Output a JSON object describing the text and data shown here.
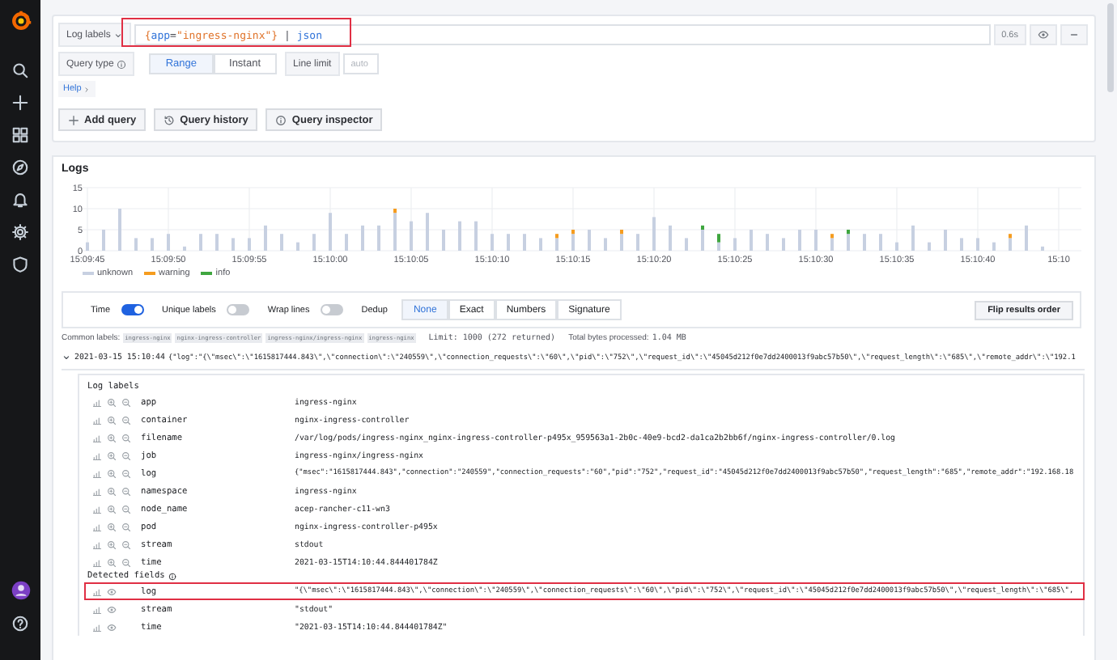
{
  "query_editor": {
    "label_browser": "Log labels",
    "highlighted": true,
    "query_tokens": [
      {
        "text": "{",
        "kind": "brace"
      },
      {
        "text": "app",
        "kind": "label"
      },
      {
        "text": "=",
        "kind": "op"
      },
      {
        "text": "\"ingress-nginx\"",
        "kind": "string"
      },
      {
        "text": "}",
        "kind": "brace"
      },
      {
        "text": " | ",
        "kind": "op"
      },
      {
        "text": "json",
        "kind": "func"
      }
    ],
    "duration": "0.6s",
    "query_type_label": "Query type",
    "query_types": [
      {
        "label": "Range",
        "selected": true
      },
      {
        "label": "Instant",
        "selected": false
      }
    ],
    "line_limit_label": "Line limit",
    "line_limit_placeholder": "auto",
    "help": "Help",
    "buttons": [
      {
        "label": "Add query",
        "kind": "add"
      },
      {
        "label": "Query history",
        "kind": "history"
      },
      {
        "label": "Query inspector",
        "kind": "inspector"
      }
    ]
  },
  "logs": {
    "title": "Logs",
    "chart_data": {
      "type": "bar",
      "stacked": true,
      "grid": true,
      "categories": [
        "15:09:45",
        null,
        null,
        null,
        null,
        "15:09:50",
        null,
        null,
        null,
        null,
        "15:09:55",
        null,
        null,
        null,
        null,
        "15:10:00",
        null,
        null,
        null,
        null,
        "15:10:05",
        null,
        null,
        null,
        null,
        "15:10:10",
        null,
        null,
        null,
        null,
        "15:10:15",
        null,
        null,
        null,
        null,
        "15:10:20",
        null,
        null,
        null,
        null,
        "15:10:25",
        null,
        null,
        null,
        null,
        "15:10:30",
        null,
        null,
        null,
        null,
        "15:10:35",
        null,
        null,
        null,
        null,
        "15:10:40",
        null,
        null,
        null,
        null,
        "15:10"
      ],
      "series": [
        {
          "name": "unknown",
          "color": "#c7d0e1",
          "values": [
            2,
            5,
            10,
            3,
            3,
            4,
            1,
            4,
            4,
            3,
            3,
            6,
            4,
            2,
            4,
            9,
            4,
            6,
            6,
            9,
            7,
            9,
            5,
            7,
            7,
            4,
            4,
            4,
            3,
            3,
            4,
            5,
            3,
            4,
            4,
            8,
            6,
            3,
            5,
            2,
            3,
            5,
            4,
            3,
            5,
            5,
            3,
            4,
            4,
            4,
            2,
            6,
            2,
            5,
            3,
            3,
            2,
            3,
            6,
            1,
            null
          ]
        },
        {
          "name": "warning",
          "color": "#f59c1f",
          "values": [
            0,
            0,
            0,
            0,
            0,
            0,
            0,
            0,
            0,
            0,
            0,
            0,
            0,
            0,
            0,
            0,
            0,
            0,
            0,
            1,
            0,
            0,
            0,
            0,
            0,
            0,
            0,
            0,
            0,
            1,
            1,
            0,
            0,
            1,
            0,
            0,
            0,
            0,
            0,
            0,
            0,
            0,
            0,
            0,
            0,
            0,
            1,
            0,
            0,
            0,
            0,
            0,
            0,
            0,
            0,
            0,
            0,
            1,
            0,
            0,
            null
          ]
        },
        {
          "name": "info",
          "color": "#3fa63f",
          "values": [
            0,
            0,
            0,
            0,
            0,
            0,
            0,
            0,
            0,
            0,
            0,
            0,
            0,
            0,
            0,
            0,
            0,
            0,
            0,
            0,
            0,
            0,
            0,
            0,
            0,
            0,
            0,
            0,
            0,
            0,
            0,
            0,
            0,
            0,
            0,
            0,
            0,
            0,
            1,
            2,
            0,
            0,
            0,
            0,
            0,
            0,
            0,
            1,
            0,
            0,
            0,
            0,
            0,
            0,
            0,
            0,
            0,
            0,
            0,
            0,
            null
          ]
        }
      ],
      "ylim": [
        0,
        15
      ],
      "yticks": [
        0,
        5,
        10,
        15
      ]
    },
    "toggles": [
      {
        "label": "Time",
        "on": true
      },
      {
        "label": "Unique labels",
        "on": false
      },
      {
        "label": "Wrap lines",
        "on": false
      }
    ],
    "dedup": {
      "label": "Dedup",
      "options": [
        {
          "label": "None",
          "selected": true
        },
        {
          "label": "Exact",
          "selected": false
        },
        {
          "label": "Numbers",
          "selected": false
        },
        {
          "label": "Signature",
          "selected": false
        }
      ]
    },
    "flip_button": "Flip results order",
    "common_labels": {
      "label": "Common labels:",
      "tags": [
        "ingress-nginx",
        "nginx-ingress-controller",
        "ingress-nginx/ingress-nginx",
        "ingress-nginx"
      ]
    },
    "limit": "Limit: 1000 (272 returned)",
    "bytes_label": "Total bytes processed:",
    "bytes_value": "1.04 MB",
    "entry": {
      "expanded": true,
      "time": "2021-03-15 15:10:44",
      "line": "{\"log\":\"{\\\"msec\\\":\\\"1615817444.843\\\",\\\"connection\\\":\\\"240559\\\",\\\"connection_requests\\\":\\\"60\\\",\\\"pid\\\":\\\"752\\\",\\\"request_id\\\":\\\"45045d212f0e7dd2400013f9abc57b50\\\",\\\"request_length\\\":\\\"685\\\",\\\"remote_addr\\\":\\\"192.1"
    },
    "log_labels": {
      "title": "Log labels",
      "rows": [
        {
          "key": "app",
          "value": "ingress-nginx"
        },
        {
          "key": "container",
          "value": "nginx-ingress-controller"
        },
        {
          "key": "filename",
          "value": "/var/log/pods/ingress-nginx_nginx-ingress-controller-p495x_959563a1-2b0c-40e9-bcd2-da1ca2b2bb6f/nginx-ingress-controller/0.log"
        },
        {
          "key": "job",
          "value": "ingress-nginx/ingress-nginx"
        },
        {
          "key": "log",
          "value": "{\"msec\":\"1615817444.843\",\"connection\":\"240559\",\"connection_requests\":\"60\",\"pid\":\"752\",\"request_id\":\"45045d212f0e7dd2400013f9abc57b50\",\"request_length\":\"685\",\"remote_addr\":\"192.168.18"
        },
        {
          "key": "namespace",
          "value": "ingress-nginx"
        },
        {
          "key": "node_name",
          "value": "acep-rancher-c11-wn3"
        },
        {
          "key": "pod",
          "value": "nginx-ingress-controller-p495x"
        },
        {
          "key": "stream",
          "value": "stdout"
        },
        {
          "key": "time",
          "value": "2021-03-15T14:10:44.844401784Z"
        }
      ]
    },
    "detected_fields": {
      "title": "Detected fields",
      "rows": [
        {
          "key": "log",
          "value": "\"{\\\"msec\\\":\\\"1615817444.843\\\",\\\"connection\\\":\\\"240559\\\",\\\"connection_requests\\\":\\\"60\\\",\\\"pid\\\":\\\"752\\\",\\\"request_id\\\":\\\"45045d212f0e7dd2400013f9abc57b50\\\",\\\"request_length\\\":\\\"685\\\",",
          "highlighted": true
        },
        {
          "key": "stream",
          "value": "\"stdout\"",
          "highlighted": false
        },
        {
          "key": "time",
          "value": "\"2021-03-15T14:10:44.844401784Z\"",
          "highlighted": false
        }
      ]
    }
  }
}
